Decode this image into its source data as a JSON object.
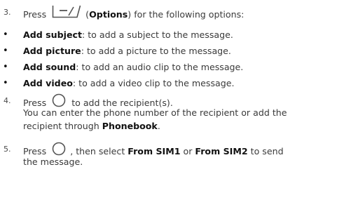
{
  "step3": {
    "number": "3.",
    "press": "Press",
    "options_label": "Options",
    "after_options": "for the following options:",
    "icon": "options-softkey-icon"
  },
  "bullets": [
    {
      "term": "Add subject",
      "desc": ": to add a subject to the message."
    },
    {
      "term": "Add picture",
      "desc": ": to add a picture to the message."
    },
    {
      "term": "Add sound",
      "desc": ": to add an audio clip to the message."
    },
    {
      "term": "Add video",
      "desc": ": to add a video clip to the message."
    }
  ],
  "step4": {
    "number": "4.",
    "press": "Press",
    "after_icon": "to add the recipient(s).",
    "line2": "You can enter the phone number of the recipient or add the",
    "line3_pre": "recipient through",
    "phonebook": "Phonebook",
    "line3_post": ".",
    "icon": "center-key-icon"
  },
  "step5": {
    "number": "5.",
    "press": "Press",
    "after_icon": ", then select",
    "sim1": "From SIM1",
    "or": "or",
    "sim2": "From SIM2",
    "to_send": "to send",
    "line2": "the message.",
    "icon": "center-key-icon"
  }
}
